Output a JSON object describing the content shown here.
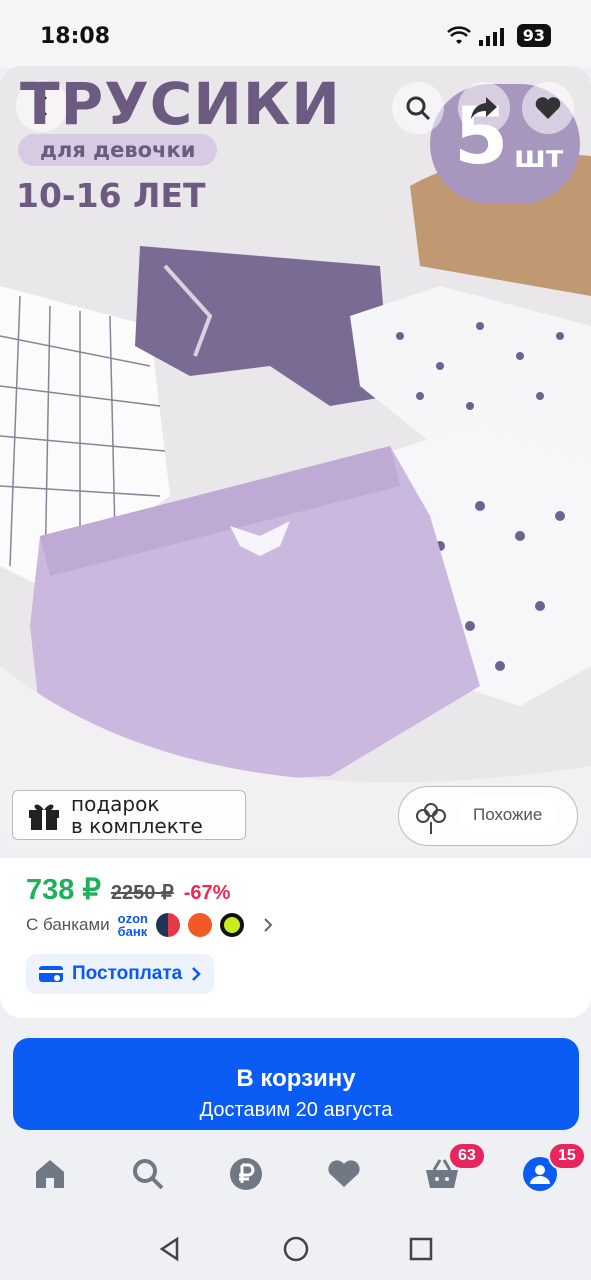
{
  "status": {
    "time": "18:08",
    "battery": "93"
  },
  "image": {
    "title": "ТРУСИКИ",
    "subtitle": "для девочки",
    "age": "10-16 ЛЕТ",
    "count_number": "5",
    "count_unit": "шт",
    "gift_text_line1": "подарок",
    "gift_text_line2": "в комплекте",
    "similar_label": "Похожие"
  },
  "price": {
    "current": "738 ₽",
    "old": "2250 ₽",
    "discount": "-67%",
    "bank_label": "С банками",
    "ozon_line1": "ozon",
    "ozon_line2": "банк",
    "postpay_label": "Постоплата"
  },
  "cart": {
    "title": "В корзину",
    "subtitle": "Доставим 20 августа"
  },
  "tabs": {
    "cart_badge": "63",
    "profile_badge": "15"
  },
  "colors": {
    "accent": "#0b5bf5",
    "price_green": "#1eb15a",
    "discount_red": "#f0274e",
    "badge": "#e8255d",
    "brand_purple": "#6c5a80"
  }
}
